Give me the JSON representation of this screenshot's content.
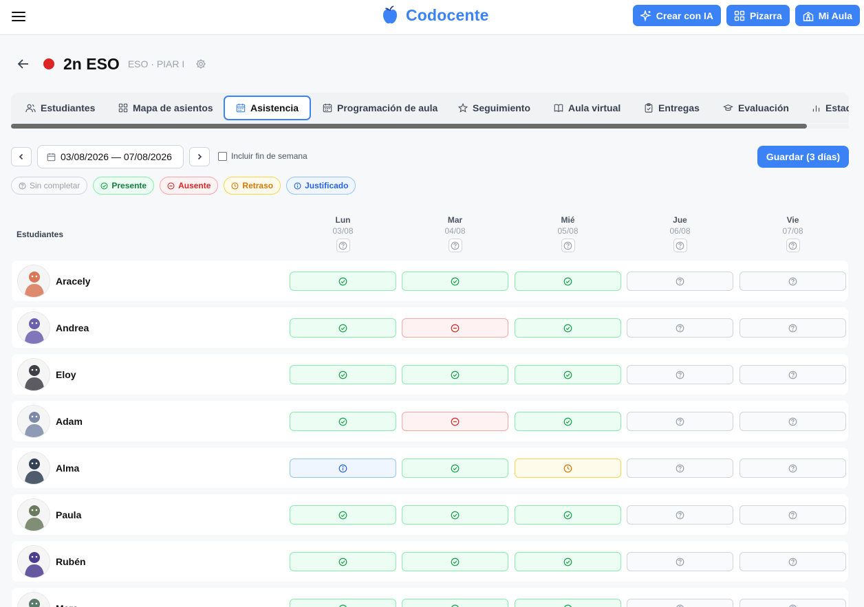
{
  "app": {
    "name": "Codocente"
  },
  "topbar": {
    "buttons": [
      {
        "label": "Crear con IA",
        "icon": "sparkles-icon"
      },
      {
        "label": "Pizarra",
        "icon": "grid-icon"
      },
      {
        "label": "Mi Aula",
        "icon": "school-icon"
      }
    ]
  },
  "header": {
    "title": "2n ESO",
    "meta": "ESO · PIAR I",
    "dot_color": "#dc2626"
  },
  "tabs": [
    {
      "label": "Estudiantes",
      "icon": "users-icon"
    },
    {
      "label": "Mapa de asientos",
      "icon": "grid-icon"
    },
    {
      "label": "Asistencia",
      "icon": "calendar-icon",
      "active": true
    },
    {
      "label": "Programación de aula",
      "icon": "calendar-icon"
    },
    {
      "label": "Seguimiento",
      "icon": "star-icon"
    },
    {
      "label": "Aula virtual",
      "icon": "book-icon"
    },
    {
      "label": "Entregas",
      "icon": "clipboard-icon"
    },
    {
      "label": "Evaluación",
      "icon": "graduation-cap-icon"
    },
    {
      "label": "Estad",
      "icon": "bar-chart-icon"
    }
  ],
  "controls": {
    "date_range": "03/08/2026 — 07/08/2026",
    "weekend_label": "Incluir fin de semana",
    "save_label": "Guardar (3 días)"
  },
  "legend": {
    "none": "Sin completar",
    "present": "Presente",
    "absent": "Ausente",
    "late": "Retraso",
    "justified": "Justificado"
  },
  "grid": {
    "students_label": "Estudiantes",
    "days": [
      {
        "name": "Lun",
        "date": "03/08"
      },
      {
        "name": "Mar",
        "date": "04/08"
      },
      {
        "name": "Mié",
        "date": "05/08"
      },
      {
        "name": "Jue",
        "date": "06/08"
      },
      {
        "name": "Vie",
        "date": "07/08"
      }
    ],
    "students": [
      {
        "name": "Aracely",
        "status": [
          "p",
          "p",
          "p",
          "n",
          "n"
        ]
      },
      {
        "name": "Andrea",
        "status": [
          "p",
          "a",
          "p",
          "n",
          "n"
        ]
      },
      {
        "name": "Eloy",
        "status": [
          "p",
          "p",
          "p",
          "n",
          "n"
        ]
      },
      {
        "name": "Adam",
        "status": [
          "p",
          "a",
          "p",
          "n",
          "n"
        ]
      },
      {
        "name": "Alma",
        "status": [
          "j",
          "p",
          "l",
          "n",
          "n"
        ]
      },
      {
        "name": "Paula",
        "status": [
          "p",
          "p",
          "p",
          "n",
          "n"
        ]
      },
      {
        "name": "Rubén",
        "status": [
          "p",
          "p",
          "p",
          "n",
          "n"
        ]
      },
      {
        "name": "Mara",
        "status": [
          "p",
          "p",
          "p",
          "n",
          "n"
        ]
      }
    ]
  },
  "colors": {
    "accent": "#3b82f6",
    "present": "#16a34a",
    "absent": "#dc2626",
    "late": "#d97706",
    "justified": "#2563eb",
    "none": "#9ca3af"
  }
}
